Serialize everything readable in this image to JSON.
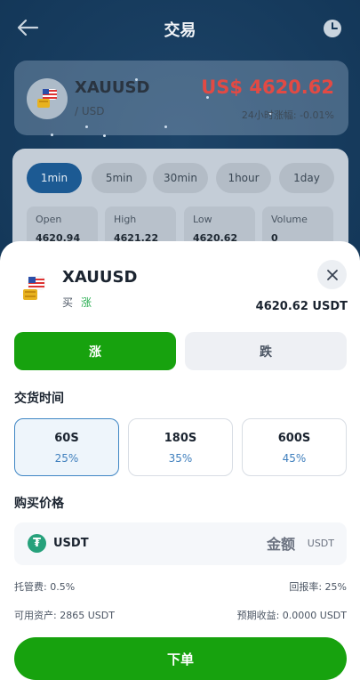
{
  "topbar": {
    "title": "交易"
  },
  "price_card": {
    "symbol": "XAUUSD",
    "sub": "/ USD",
    "price": "US$ 4620.62",
    "change": "24小时涨幅: -0.01%"
  },
  "intervals": [
    "1min",
    "5min",
    "30min",
    "1hour",
    "1day"
  ],
  "stats": [
    {
      "label": "Open",
      "value": "4620.94"
    },
    {
      "label": "High",
      "value": "4621.22"
    },
    {
      "label": "Low",
      "value": "4620.62"
    },
    {
      "label": "Volume",
      "value": "0"
    }
  ],
  "sheet": {
    "symbol": "XAUUSD",
    "side": "买",
    "direction": "涨",
    "price": "4620.62 USDT",
    "up_label": "涨",
    "down_label": "跌",
    "delivery_title": "交货时间",
    "durations": [
      {
        "time": "60S",
        "rate": "25%"
      },
      {
        "time": "180S",
        "rate": "35%"
      },
      {
        "time": "600S",
        "rate": "45%"
      }
    ],
    "price_title": "购买价格",
    "coin": "USDT",
    "amount_placeholder": "金额",
    "amount_unit": "USDT",
    "fee": "托管费: 0.5%",
    "return_rate": "回报率: 25%",
    "available": "可用资产: 2865 USDT",
    "expected": "预期收益: 0.0000 USDT",
    "submit": "下单"
  },
  "colors": {
    "primary_green": "#17a20e",
    "price_red": "#e24a44",
    "up_green": "#2aae52"
  }
}
